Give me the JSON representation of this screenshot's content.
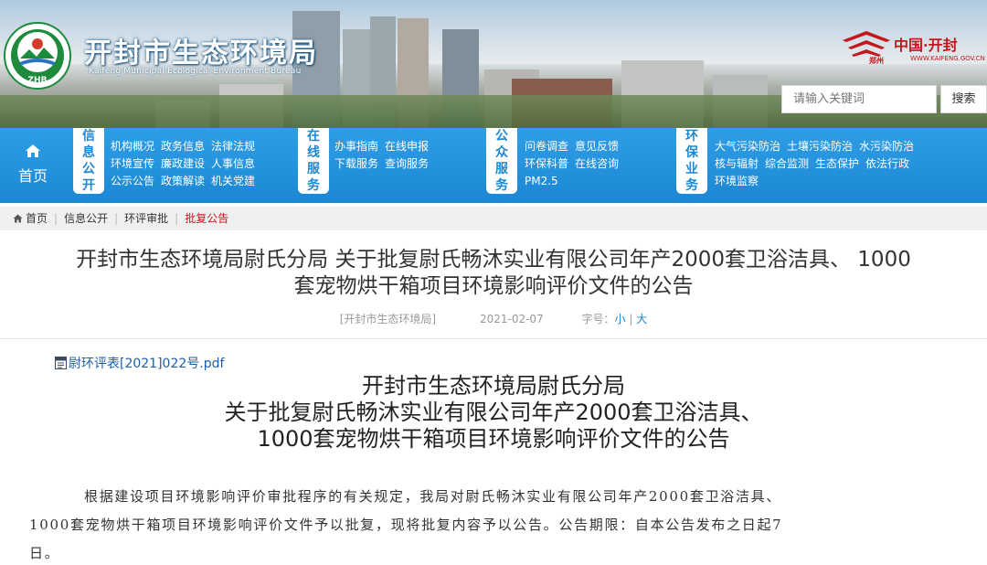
{
  "header": {
    "site_title": "开封市生态环境局",
    "site_subtitle": "Kaifeng Municipal Ecological Environment Bureau",
    "logo_text": "ZHB",
    "city_logo_main": "中国·开封",
    "city_logo_mark": "郑州",
    "city_logo_sub": "WWW.KAIFENG.GOV.CN",
    "search_placeholder": "请输入关键词",
    "search_button": "搜索"
  },
  "nav": {
    "home_label": "首页",
    "groups": [
      {
        "tag": [
          "信",
          "息",
          "公",
          "开"
        ],
        "rows": [
          [
            "机构概况",
            "政务信息",
            "法律法规"
          ],
          [
            "环境宣传",
            "廉政建设",
            "人事信息"
          ],
          [
            "公示公告",
            "政策解读",
            "机关党建"
          ]
        ]
      },
      {
        "tag": [
          "在",
          "线",
          "服",
          "务"
        ],
        "rows": [
          [
            "办事指南",
            "在线申报"
          ],
          [
            "下载服务",
            "查询服务"
          ]
        ]
      },
      {
        "tag": [
          "公",
          "众",
          "服",
          "务"
        ],
        "rows": [
          [
            "问卷调查",
            "意见反馈"
          ],
          [
            "环保科普",
            "在线咨询"
          ],
          [
            "PM2.5"
          ]
        ]
      },
      {
        "tag": [
          "环",
          "保",
          "业",
          "务"
        ],
        "rows": [
          [
            "大气污染防治",
            "土壤污染防治",
            "水污染防治"
          ],
          [
            "核与辐射",
            "综合监测",
            "生态保护",
            "依法行政"
          ],
          [
            "环境监察"
          ]
        ]
      }
    ]
  },
  "breadcrumb": [
    "首页",
    "信息公开",
    "环评审批",
    "批复公告"
  ],
  "article": {
    "title_line1": "开封市生态环境局尉氏分局 关于批复尉氏畅沐实业有限公司年产2000套卫浴洁具、 1000",
    "title_line2": "套宠物烘干箱项目环境影响评价文件的公告",
    "source": "[开封市生态环境局]",
    "date": "2021-02-07",
    "font_size_label": "字号：",
    "font_small": "小",
    "font_large": "大",
    "attachment": "尉环评表[2021]022号.pdf",
    "doc_title_lines": [
      "开封市生态环境局尉氏分局",
      "关于批复尉氏畅沐实业有限公司年产2000套卫浴洁具、",
      "1000套宠物烘干箱项目环境影响评价文件的公告"
    ],
    "body_line1": "根据建设项目环境影响评价审批程序的有关规定，我局对尉氏畅沐实业有限公司年产2000套卫浴洁具、",
    "body_line2": "1000套宠物烘干箱项目环境影响评价文件予以批复，现将批复内容予以公告。公告期限：自本公告发布之日起7",
    "body_line3": "日。"
  }
}
